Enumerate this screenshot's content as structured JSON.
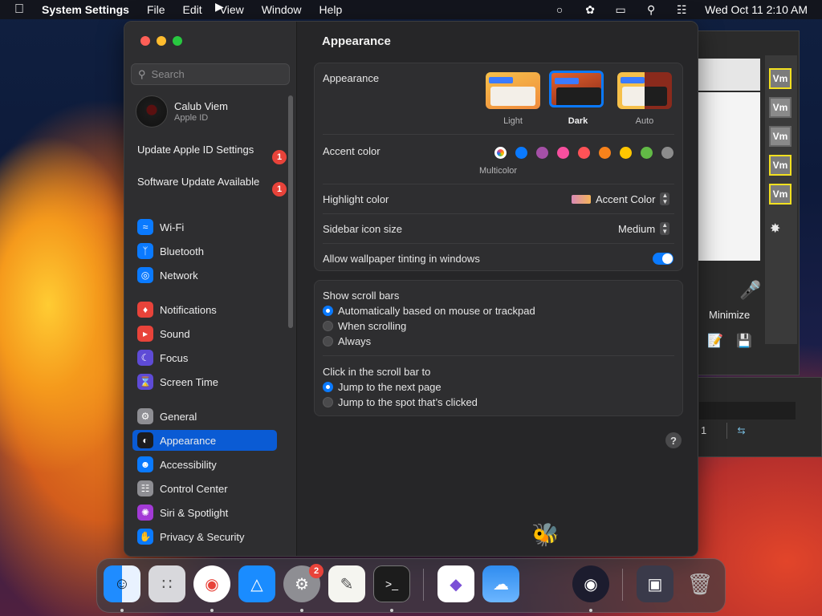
{
  "menubar": {
    "app_name": "System Settings",
    "menus": [
      "File",
      "Edit",
      "View",
      "Window",
      "Help"
    ],
    "clock": "Wed Oct 11  2:10 AM",
    "status_icons": [
      "creative-cloud-icon",
      "bee-icon",
      "screen-mirroring-icon",
      "search-icon",
      "control-center-icon"
    ]
  },
  "search": {
    "placeholder": "Search"
  },
  "account": {
    "name": "Calub Viem",
    "subtitle": "Apple ID"
  },
  "notices": [
    {
      "label": "Update Apple ID Settings",
      "count": "1"
    },
    {
      "label": "Software Update Available",
      "count": "1"
    }
  ],
  "sidebar": {
    "items": [
      {
        "label": "Wi-Fi",
        "icon": "wifi-icon",
        "color": "#0a7aff"
      },
      {
        "label": "Bluetooth",
        "icon": "bluetooth-icon",
        "color": "#0a7aff"
      },
      {
        "label": "Network",
        "icon": "globe-icon",
        "color": "#0a7aff"
      },
      {
        "label": "Notifications",
        "icon": "bell-icon",
        "color": "#e8433a"
      },
      {
        "label": "Sound",
        "icon": "speaker-icon",
        "color": "#e8433a"
      },
      {
        "label": "Focus",
        "icon": "moon-icon",
        "color": "#5e4bd6"
      },
      {
        "label": "Screen Time",
        "icon": "hourglass-icon",
        "color": "#5e4bd6"
      },
      {
        "label": "General",
        "icon": "gear-icon",
        "color": "#8e8e93"
      },
      {
        "label": "Appearance",
        "icon": "appearance-icon",
        "color": "#1c1c1e"
      },
      {
        "label": "Accessibility",
        "icon": "accessibility-icon",
        "color": "#0a7aff"
      },
      {
        "label": "Control Center",
        "icon": "control-center-icon",
        "color": "#8e8e93"
      },
      {
        "label": "Siri & Spotlight",
        "icon": "siri-icon",
        "color": "#a33ad6"
      },
      {
        "label": "Privacy & Security",
        "icon": "hand-icon",
        "color": "#0a7aff"
      }
    ],
    "selected": "Appearance"
  },
  "content": {
    "title": "Appearance",
    "appearance": {
      "label": "Appearance",
      "options": [
        "Light",
        "Dark",
        "Auto"
      ],
      "selected": "Dark"
    },
    "accent": {
      "label": "Accent color",
      "colors": [
        "multicolor",
        "#0a7aff",
        "#a550a7",
        "#f74f9e",
        "#ff5257",
        "#f7821b",
        "#ffc600",
        "#62ba46",
        "#8c8c8c"
      ],
      "selected_label": "Multicolor"
    },
    "highlight": {
      "label": "Highlight color",
      "value": "Accent Color"
    },
    "sidebar_icon_size": {
      "label": "Sidebar icon size",
      "value": "Medium"
    },
    "wallpaper_tinting": {
      "label": "Allow wallpaper tinting in windows",
      "enabled": true
    },
    "scroll_bars": {
      "label": "Show scroll bars",
      "options": [
        "Automatically based on mouse or trackpad",
        "When scrolling",
        "Always"
      ],
      "selected": "Automatically based on mouse or trackpad"
    },
    "click_scroll_bar": {
      "label": "Click in the scroll bar to",
      "options": [
        "Jump to the next page",
        "Jump to the spot that’s clicked"
      ],
      "selected": "Jump to the next page"
    },
    "help": "?"
  },
  "background_window": {
    "vm_labels": [
      "Vm",
      "Vm",
      "Vm",
      "Vm",
      "Vm"
    ],
    "minimize_label": "Minimize",
    "count": "1"
  },
  "dock": {
    "apps": [
      "Finder",
      "Launchpad",
      "Chrome",
      "App Store",
      "System Settings",
      "TextEdit",
      "Terminal",
      "Visual Studio",
      "Weather",
      "OBS",
      "Screen Saver",
      "Trash"
    ],
    "settings_badge": "2"
  }
}
